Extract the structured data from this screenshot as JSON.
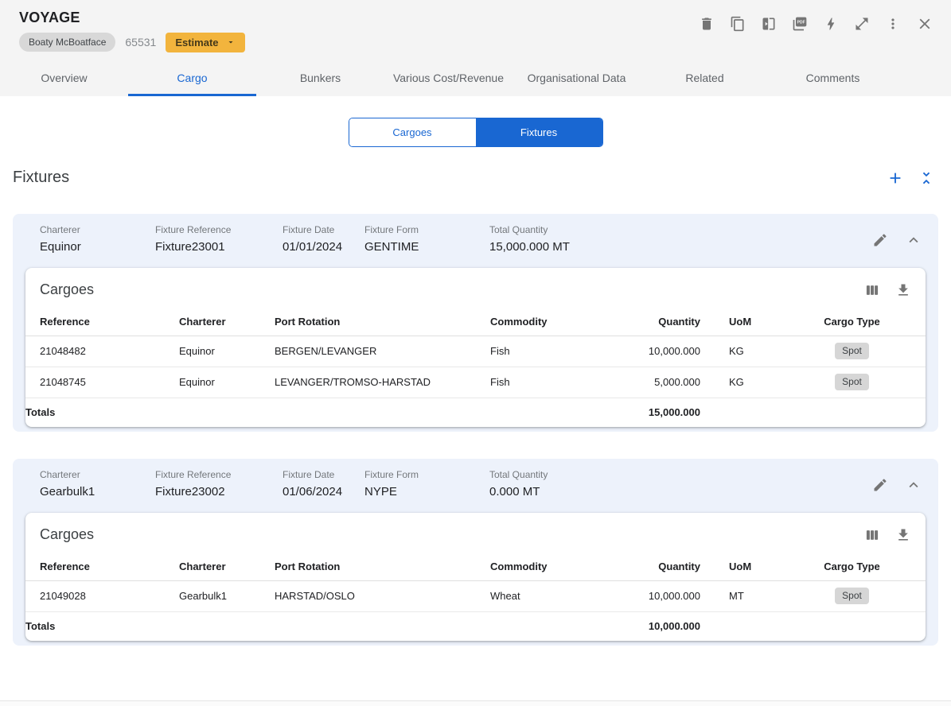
{
  "header": {
    "title": "VOYAGE",
    "vessel_tag": "Boaty McBoatface",
    "voyage_number": "65531",
    "estimate_label": "Estimate"
  },
  "tabs": {
    "items": [
      "Overview",
      "Cargo",
      "Bunkers",
      "Various Cost/Revenue",
      "Organisational Data",
      "Related",
      "Comments"
    ],
    "active": "Cargo"
  },
  "view_toggle": {
    "cargoes": "Cargoes",
    "fixtures": "Fixtures",
    "selected": "Fixtures"
  },
  "section": {
    "title": "Fixtures"
  },
  "labels": {
    "charterer": "Charterer",
    "fixture_reference": "Fixture Reference",
    "fixture_date": "Fixture Date",
    "fixture_form": "Fixture Form",
    "total_quantity": "Total Quantity",
    "cargoes": "Cargoes",
    "totals": "Totals"
  },
  "table_headers": {
    "reference": "Reference",
    "charterer": "Charterer",
    "port_rotation": "Port Rotation",
    "commodity": "Commodity",
    "quantity": "Quantity",
    "uom": "UoM",
    "cargo_type": "Cargo Type"
  },
  "fixtures": [
    {
      "charterer": "Equinor",
      "fixture_reference": "Fixture23001",
      "fixture_date": "01/01/2024",
      "fixture_form": "GENTIME",
      "total_quantity": "15,000.000 MT",
      "cargo_rows": [
        {
          "reference": "21048482",
          "charterer": "Equinor",
          "port_rotation": "BERGEN/LEVANGER",
          "commodity": "Fish",
          "quantity": "10,000.000",
          "uom": "KG",
          "cargo_type": "Spot"
        },
        {
          "reference": "21048745",
          "charterer": "Equinor",
          "port_rotation": "LEVANGER/TROMSO-HARSTAD",
          "commodity": "Fish",
          "quantity": "5,000.000",
          "uom": "KG",
          "cargo_type": "Spot"
        }
      ],
      "totals_quantity": "15,000.000"
    },
    {
      "charterer": "Gearbulk1",
      "fixture_reference": "Fixture23002",
      "fixture_date": "01/06/2024",
      "fixture_form": "NYPE",
      "total_quantity": "0.000 MT",
      "cargo_rows": [
        {
          "reference": "21049028",
          "charterer": "Gearbulk1",
          "port_rotation": "HARSTAD/OSLO",
          "commodity": "Wheat",
          "quantity": "10,000.000",
          "uom": "MT",
          "cargo_type": "Spot"
        }
      ],
      "totals_quantity": "10,000.000"
    }
  ],
  "icons": {
    "toolbar": [
      "delete-icon",
      "copy-icon",
      "compare-icon",
      "pdf-icon",
      "bolt-icon",
      "expand-icon",
      "more-vert-icon",
      "close-icon"
    ],
    "fixtures_section": [
      "add-icon",
      "collapse-all-icon"
    ],
    "fixture_card": [
      "edit-icon",
      "chevron-up-icon"
    ],
    "cargo_table": [
      "columns-icon",
      "download-icon"
    ]
  },
  "colors": {
    "accent_blue": "#1967d2",
    "estimate_yellow": "#f2b43d",
    "fixture_card_bg": "#edf2fb",
    "chip_gray": "#d8d8d8",
    "spot_chip_gray": "#d6d6d6",
    "icon_gray": "#757575",
    "topbar_gray": "#f4f4f4"
  }
}
